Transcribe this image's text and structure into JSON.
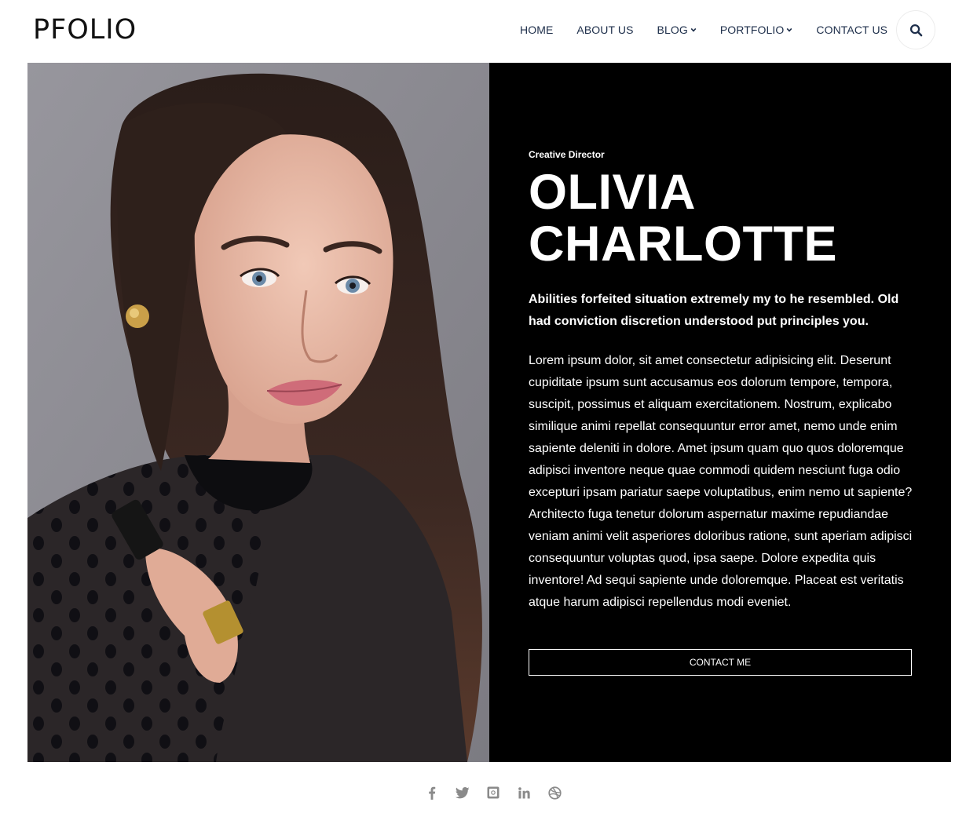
{
  "header": {
    "logo": "PFOLIO",
    "nav": [
      {
        "label": "HOME",
        "has_dropdown": false
      },
      {
        "label": "ABOUT US",
        "has_dropdown": false
      },
      {
        "label": "BLOG",
        "has_dropdown": true
      },
      {
        "label": "PORTFOLIO",
        "has_dropdown": true
      },
      {
        "label": "CONTACT US",
        "has_dropdown": false
      }
    ],
    "search_icon": "search-icon"
  },
  "hero": {
    "role": "Creative Director",
    "name_line1": "OLIVIA",
    "name_line2": "CHARLOTTE",
    "lead": "Abilities forfeited situation extremely my to he resembled. Old had conviction discretion understood put principles you.",
    "body": "Lorem ipsum dolor, sit amet consectetur adipisicing elit. Deserunt cupiditate ipsum sunt accusamus eos dolorum tempore, tempora, suscipit, possimus et aliquam exercitationem. Nostrum, explicabo similique animi repellat consequuntur error amet, nemo unde enim sapiente deleniti in dolore. Amet ipsum quam quo quos doloremque adipisci inventore neque quae commodi quidem nesciunt fuga odio excepturi ipsam pariatur saepe voluptatibus, enim nemo ut sapiente? Architecto fuga tenetur dolorum aspernatur maxime repudiandae veniam animi velit asperiores doloribus ratione, sunt aperiam adipisci consequuntur voluptas quod, ipsa saepe. Dolore expedita quis inventore! Ad sequi sapiente unde doloremque. Placeat est veritatis atque harum adipisci repellendus modi eveniet.",
    "cta_label": "CONTACT ME"
  },
  "social": {
    "icons": [
      "facebook-icon",
      "twitter-icon",
      "instagram-icon",
      "linkedin-icon",
      "dribbble-icon"
    ]
  },
  "colors": {
    "panel_bg": "#000000",
    "nav_text": "#1d2e4a",
    "social_icon": "#8a8a8a"
  }
}
